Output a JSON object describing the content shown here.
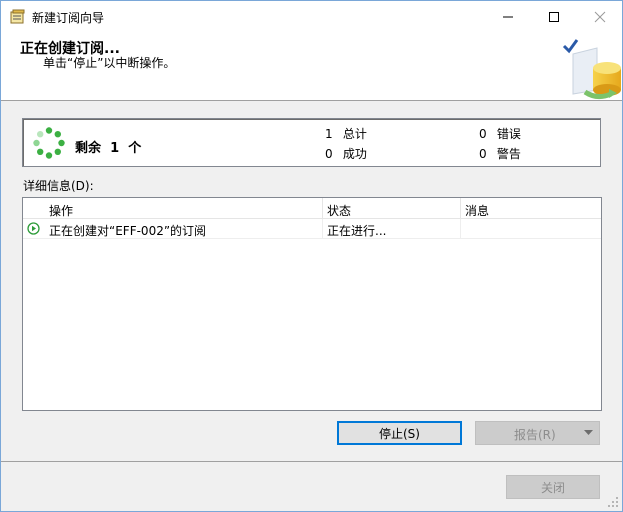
{
  "window": {
    "title": "新建订阅向导"
  },
  "header": {
    "title": "正在创建订阅...",
    "subtitle": "单击“停止”以中断操作。"
  },
  "summary": {
    "remaining_label": "剩余",
    "remaining_count": "1",
    "remaining_unit": "个",
    "total_count": "1",
    "total_label": "总计",
    "success_count": "0",
    "success_label": "成功",
    "error_count": "0",
    "error_label": "错误",
    "warning_count": "0",
    "warning_label": "警告"
  },
  "details": {
    "label": "详细信息(D):",
    "columns": [
      "操作",
      "状态",
      "消息"
    ],
    "rows": [
      {
        "action": "正在创建对“EFF-002”的订阅",
        "status": "正在进行...",
        "message": ""
      }
    ]
  },
  "buttons": {
    "stop": "停止(S)",
    "report": "报告(R)",
    "close": "关闭"
  },
  "colors": {
    "spinner_green": "#3cb043",
    "focus_blue": "#0078d7",
    "row_icon_green": "#2e9c3a"
  }
}
